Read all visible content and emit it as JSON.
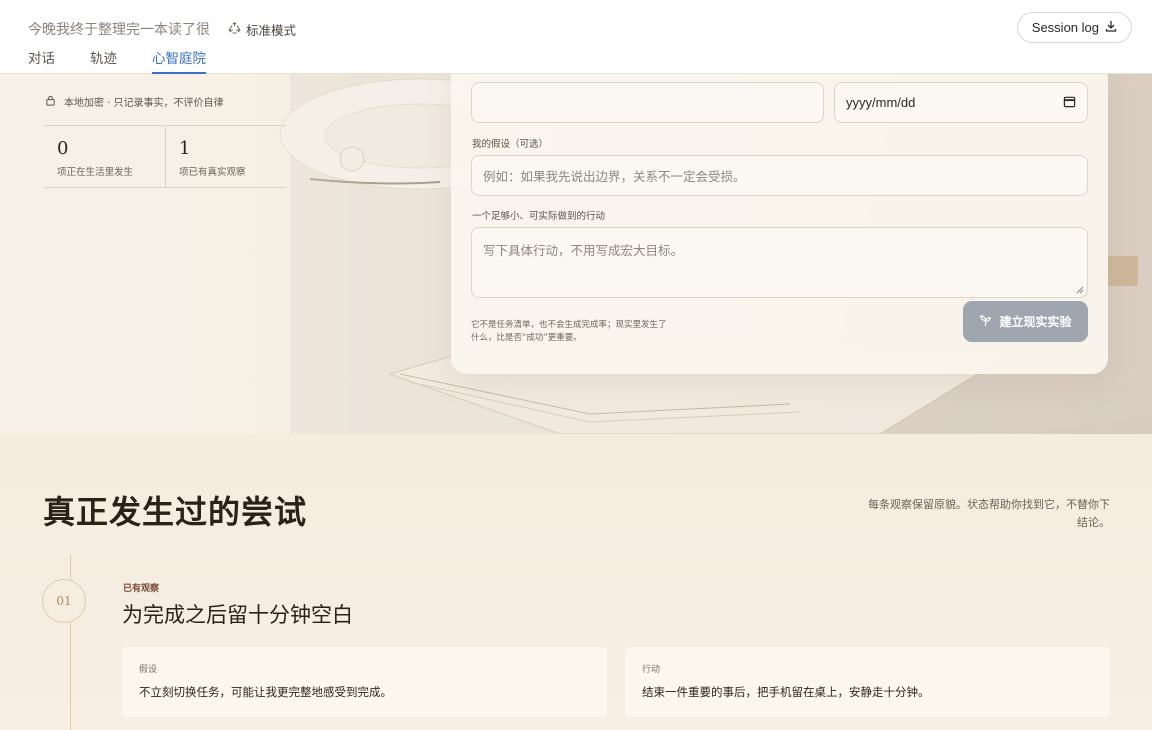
{
  "header": {
    "session_title": "今晚我终于整理完一本读了很",
    "mode_label": "标准模式",
    "session_log_label": "Session log",
    "tabs": [
      {
        "label": "对话",
        "active": false
      },
      {
        "label": "轨迹",
        "active": false
      },
      {
        "label": "心智庭院",
        "active": true
      }
    ]
  },
  "sidebar": {
    "privacy_text": "本地加密 · 只记录事实，不评价自律",
    "stats": [
      {
        "value": "0",
        "label": "项正在生活里发生"
      },
      {
        "value": "1",
        "label": "项已有真实观察"
      }
    ]
  },
  "form": {
    "date_placeholder": "yyyy/mm/dd",
    "hypothesis_label": "我的假设（可选）",
    "hypothesis_placeholder": "例如：如果我先说出边界，关系不一定会受损。",
    "action_label": "一个足够小、可实际做到的行动",
    "action_placeholder": "写下具体行动，不用写成宏大目标。",
    "note": "它不是任务清单，也不会生成完成率；现实里发生了什么，比是否“成功”更重要。",
    "submit_label": "建立现实实验"
  },
  "attempts": {
    "title": "真正发生过的尝试",
    "description": "每条观察保留原貌。状态帮助你找到它，不替你下结论。",
    "items": [
      {
        "index": "01",
        "status": "已有观察",
        "title": "为完成之后留十分钟空白",
        "hypothesis_label": "假设",
        "hypothesis": "不立刻切换任务，可能让我更完整地感受到完成。",
        "action_label": "行动",
        "action": "结束一件重要的事后，把手机留在桌上，安静走十分钟。"
      }
    ]
  },
  "colors": {
    "accent_blue": "#3b70c4",
    "submit_disabled": "#9fa6b0",
    "status_brown": "#7a4b37",
    "timeline": "#e0c9a8"
  }
}
